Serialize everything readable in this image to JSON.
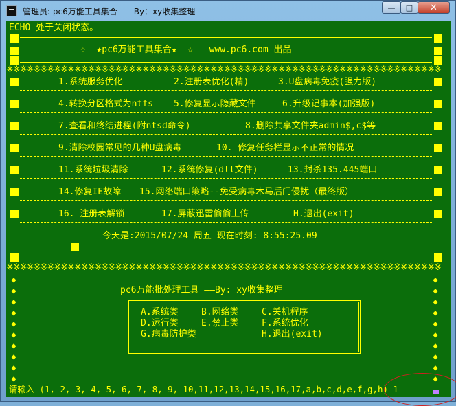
{
  "window": {
    "title": "管理员: pc6万能工具集合——By：xy收集整理",
    "minimize": "—",
    "maximize": "□",
    "close": "✕"
  },
  "console": {
    "echo_line": "ECHO 处于关闭状态。",
    "header": "☆  ★pc6万能工具集合★  ☆   www.pc6.com 出品",
    "menu": [
      [
        "1.系统服务优化",
        "2.注册表优化(精)",
        "3.U盘病毒免疫(强力版)"
      ],
      [
        "4.转换分区格式为ntfs",
        "5.修复显示隐藏文件",
        "6.升级记事本(加强版)"
      ],
      [
        "7.查看和终结进程(附ntsd命令)",
        "8.删除共享文件夹admin$,c$等"
      ],
      [
        "9.清除校园常见的几种U盘病毒",
        "10. 修复任务栏显示不正常的情况"
      ],
      [
        "11.系统垃圾清除",
        "12.系统修复(dll文件)",
        "13.封杀135.445端口"
      ],
      [
        "14.修复IE故障",
        "15.网络端口策略--免受病毒木马后门侵扰（最终版）"
      ],
      [
        "16. 注册表解锁",
        "17.屏蔽迅雷偷偷上传",
        "H.退出(exit)"
      ]
    ],
    "date_line": "今天是:2015/07/24 周五 现在时刻: 8:55:25.09",
    "sub_title": "pc6万能批处理工具 ——By: xy收集整理",
    "categories": [
      [
        "A.系统类",
        "B.网络类",
        "C.关机程序"
      ],
      [
        "D.运行类",
        "E.禁止类",
        "F.系统优化"
      ],
      [
        "G.病毒防护类",
        "",
        "H.退出(exit)"
      ]
    ],
    "prompt": "请输入 (1, 2, 3, 4, 5, 6, 7, 8, 9, 10,11,12,13,14,15,16,17,a,b,c,d,e,f,g,h) 1",
    "x_pattern": "※※※※※※※※※※※※※※※※※※※※※※※※※※※※※※※※※※※※※※※※※※※※※※※※※※※※※※※※※※※※※※※※",
    "diamond_pattern": "◆◆◆◆◆◆◆◆◆◆◆◆◆◆◆◆◆◆◆◆◆◆◆◆◆◆◆◆◆◆◆◆◆◆◆◆◆◆◆◆◆◆◆◆◆◆◆◆◆◆◆◆◆◆◆◆◆◆◆"
  },
  "colors": {
    "console_bg": "#0b6e0b",
    "console_text": "#ffff00",
    "cursor": "#c080ff",
    "annotation_circle": "#d02020"
  }
}
